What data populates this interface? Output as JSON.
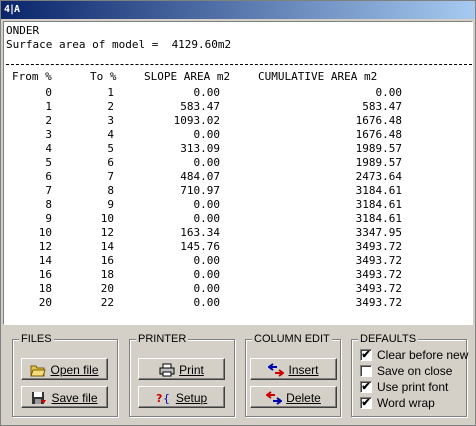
{
  "app": {
    "icon_text": "4|A"
  },
  "report": {
    "name": "ONDER",
    "surface_line": "Surface area of model =  4129.60m2",
    "columns": [
      "From %",
      "To %",
      "SLOPE AREA m2",
      "CUMULATIVE AREA m2"
    ],
    "rows": [
      [
        "0",
        "1",
        "0.00",
        "0.00"
      ],
      [
        "1",
        "2",
        "583.47",
        "583.47"
      ],
      [
        "2",
        "3",
        "1093.02",
        "1676.48"
      ],
      [
        "3",
        "4",
        "0.00",
        "1676.48"
      ],
      [
        "4",
        "5",
        "313.09",
        "1989.57"
      ],
      [
        "5",
        "6",
        "0.00",
        "1989.57"
      ],
      [
        "6",
        "7",
        "484.07",
        "2473.64"
      ],
      [
        "7",
        "8",
        "710.97",
        "3184.61"
      ],
      [
        "8",
        "9",
        "0.00",
        "3184.61"
      ],
      [
        "9",
        "10",
        "0.00",
        "3184.61"
      ],
      [
        "10",
        "12",
        "163.34",
        "3347.95"
      ],
      [
        "12",
        "14",
        "145.76",
        "3493.72"
      ],
      [
        "14",
        "16",
        "0.00",
        "3493.72"
      ],
      [
        "16",
        "18",
        "0.00",
        "3493.72"
      ],
      [
        "18",
        "20",
        "0.00",
        "3493.72"
      ],
      [
        "20",
        "22",
        "0.00",
        "3493.72"
      ]
    ]
  },
  "files": {
    "title": "FILES",
    "open": "Open file",
    "save": "Save file"
  },
  "printer": {
    "title": "PRINTER",
    "print": "Print",
    "setup": "Setup"
  },
  "column_edit": {
    "title": "COLUMN EDIT",
    "insert": "Insert",
    "delete": "Delete"
  },
  "defaults": {
    "title": "DEFAULTS",
    "items": [
      {
        "label": "Clear before new",
        "checked": true
      },
      {
        "label": "Save on close",
        "checked": false
      },
      {
        "label": "Use print font",
        "checked": true
      },
      {
        "label": "Word wrap",
        "checked": true
      }
    ]
  }
}
